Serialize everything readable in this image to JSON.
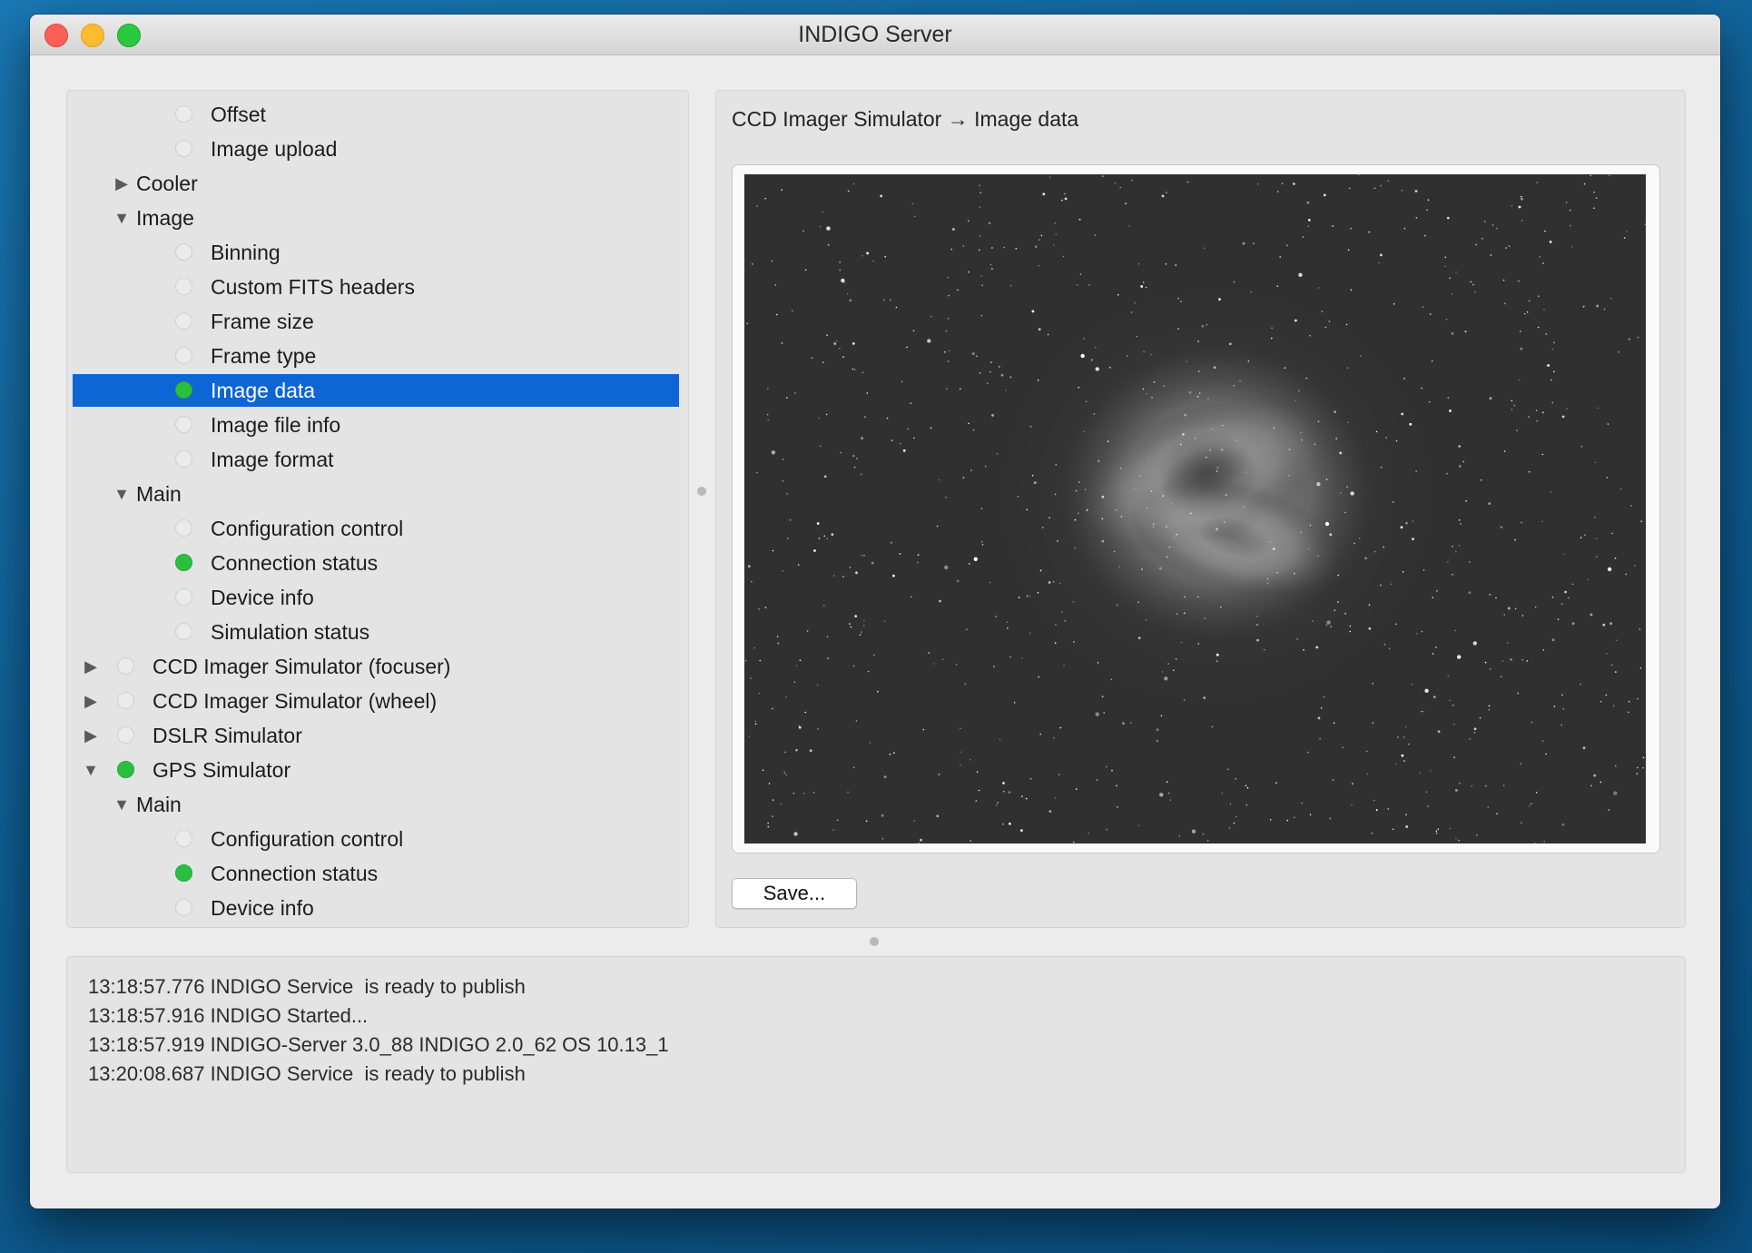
{
  "window": {
    "title": "INDIGO Server"
  },
  "tree": {
    "rows": [
      {
        "label": "Offset",
        "level": 3,
        "status": "idle",
        "toggle": ""
      },
      {
        "label": "Image upload",
        "level": 3,
        "status": "idle",
        "toggle": ""
      },
      {
        "label": "Cooler",
        "level": 2,
        "status": "",
        "toggle": "▶"
      },
      {
        "label": "Image",
        "level": 2,
        "status": "",
        "toggle": "▼"
      },
      {
        "label": "Binning",
        "level": 3,
        "status": "idle",
        "toggle": ""
      },
      {
        "label": "Custom FITS headers",
        "level": 3,
        "status": "idle",
        "toggle": ""
      },
      {
        "label": "Frame size",
        "level": 3,
        "status": "idle",
        "toggle": ""
      },
      {
        "label": "Frame type",
        "level": 3,
        "status": "idle",
        "toggle": ""
      },
      {
        "label": "Image data",
        "level": 3,
        "status": "ok",
        "toggle": "",
        "selected": true
      },
      {
        "label": "Image file info",
        "level": 3,
        "status": "idle",
        "toggle": ""
      },
      {
        "label": "Image format",
        "level": 3,
        "status": "idle",
        "toggle": ""
      },
      {
        "label": "Main",
        "level": 2,
        "status": "",
        "toggle": "▼"
      },
      {
        "label": "Configuration control",
        "level": 3,
        "status": "idle",
        "toggle": ""
      },
      {
        "label": "Connection status",
        "level": 3,
        "status": "ok",
        "toggle": ""
      },
      {
        "label": "Device info",
        "level": 3,
        "status": "idle",
        "toggle": ""
      },
      {
        "label": "Simulation status",
        "level": 3,
        "status": "idle",
        "toggle": ""
      },
      {
        "label": "CCD Imager Simulator (focuser)",
        "level": 1,
        "status": "idle",
        "toggle": "▶"
      },
      {
        "label": "CCD Imager Simulator (wheel)",
        "level": 1,
        "status": "idle",
        "toggle": "▶"
      },
      {
        "label": "DSLR Simulator",
        "level": 1,
        "status": "idle",
        "toggle": "▶"
      },
      {
        "label": "GPS Simulator",
        "level": 1,
        "status": "ok",
        "toggle": "▼"
      },
      {
        "label": "Main",
        "level": 2,
        "status": "",
        "toggle": "▼"
      },
      {
        "label": "Configuration control",
        "level": 3,
        "status": "idle",
        "toggle": ""
      },
      {
        "label": "Connection status",
        "level": 3,
        "status": "ok",
        "toggle": ""
      },
      {
        "label": "Device info",
        "level": 3,
        "status": "idle",
        "toggle": ""
      }
    ]
  },
  "detail": {
    "breadcrumb": "CCD Imager Simulator → Image data",
    "save_label": "Save..."
  },
  "log": {
    "lines": [
      "13:18:57.776 INDIGO Service  is ready to publish",
      "13:18:57.916 INDIGO Started...",
      "13:18:57.919 INDIGO-Server 3.0_88 INDIGO 2.0_62 OS 10.13_1",
      "13:20:08.687 INDIGO Service  is ready to publish"
    ]
  },
  "colors": {
    "accent": "#0e65d4",
    "status_ok": "#2bbf42",
    "status_idle": "#ebebeb"
  },
  "icons": {
    "collapsed": "triangle-right-icon",
    "expanded": "triangle-down-icon",
    "status": "status-dot-icon"
  }
}
